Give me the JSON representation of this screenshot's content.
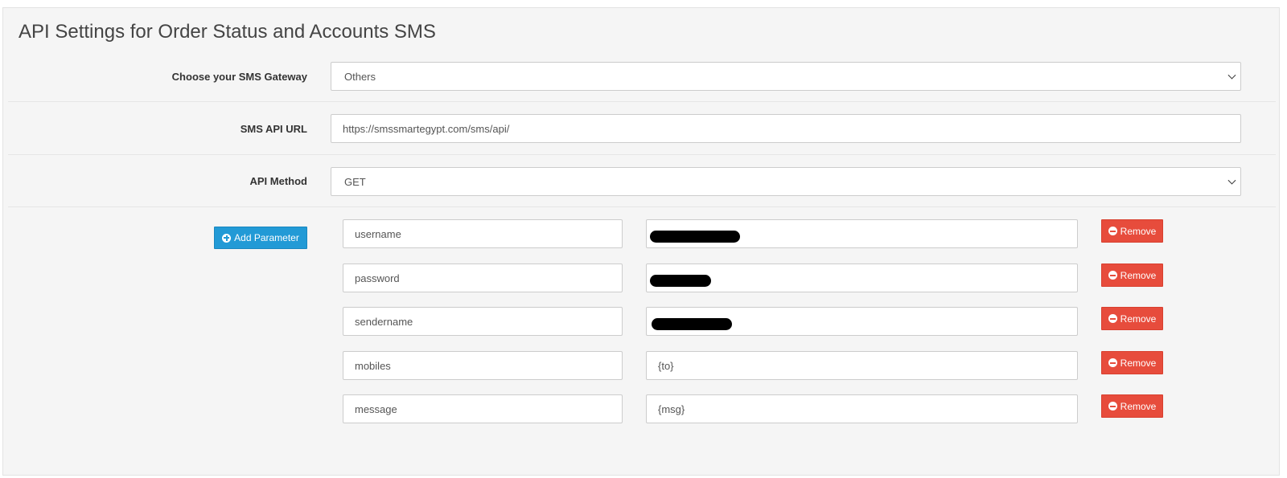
{
  "panel": {
    "title": "API Settings for Order Status and Accounts SMS"
  },
  "gateway": {
    "label": "Choose your SMS Gateway",
    "selected": "Others"
  },
  "api_url": {
    "label": "SMS API URL",
    "value": "https://smssmartegypt.com/sms/api/"
  },
  "api_method": {
    "label": "API Method",
    "selected": "GET"
  },
  "parameters": {
    "add_label": "Add Parameter",
    "remove_label": "Remove",
    "rows": [
      {
        "key": "username",
        "value": "",
        "redacted": true
      },
      {
        "key": "password",
        "value": "",
        "redacted": true
      },
      {
        "key": "sendername",
        "value": "",
        "redacted": true
      },
      {
        "key": "mobiles",
        "value": "{to}",
        "redacted": false
      },
      {
        "key": "message",
        "value": "{msg}",
        "redacted": false
      }
    ]
  },
  "icons": {
    "add": "plus-circle-icon",
    "remove": "minus-circle-icon",
    "select": "chevron-down-icon"
  },
  "colors": {
    "add_button": "#229ad6",
    "remove_button": "#e74c3c",
    "panel_bg": "#f5f5f5"
  }
}
